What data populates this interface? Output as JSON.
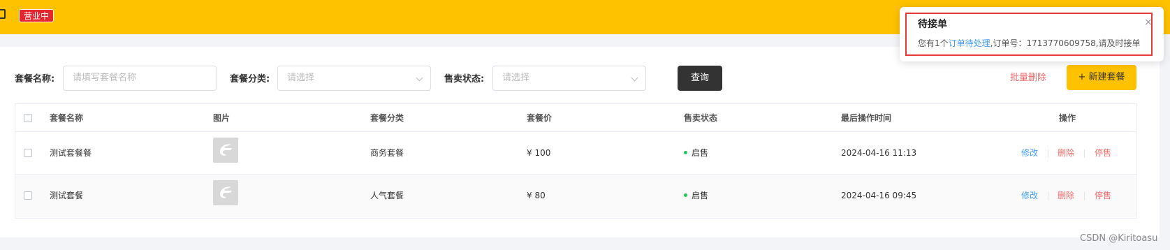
{
  "header": {
    "status_badge": "营业中"
  },
  "filters": {
    "name_label": "套餐名称:",
    "name_placeholder": "请填写套餐名称",
    "category_label": "套餐分类:",
    "category_placeholder": "请选择",
    "sale_status_label": "售卖状态:",
    "sale_status_placeholder": "请选择",
    "query_button": "查询",
    "batch_delete_button": "批量删除",
    "new_button": "+ 新建套餐"
  },
  "table": {
    "columns": [
      "套餐名称",
      "图片",
      "套餐分类",
      "套餐价",
      "售卖状态",
      "最后操作时间",
      "操作"
    ],
    "rows": [
      {
        "name": "测试套餐餐",
        "category": "商务套餐",
        "price": "¥ 100",
        "status": "启售",
        "updated": "2024-04-16 11:13",
        "actions": [
          "修改",
          "删除",
          "停售"
        ]
      },
      {
        "name": "测试套餐",
        "category": "人气套餐",
        "price": "¥ 80",
        "status": "启售",
        "updated": "2024-04-16 09:45",
        "actions": [
          "修改",
          "删除",
          "停售"
        ]
      }
    ]
  },
  "notification": {
    "title": "待接单",
    "close": "×",
    "msg_prefix": "您有1个",
    "msg_link": "订单待处理",
    "msg_suffix": ",订单号：1713770609758,请及时接单"
  },
  "watermark": "CSDN @Kiritoasu",
  "colors": {
    "brand_yellow": "#ffc200",
    "badge_red": "#e6262e",
    "link_blue": "#419eff",
    "danger_red": "#f56c6c",
    "status_green": "#22c55e"
  }
}
